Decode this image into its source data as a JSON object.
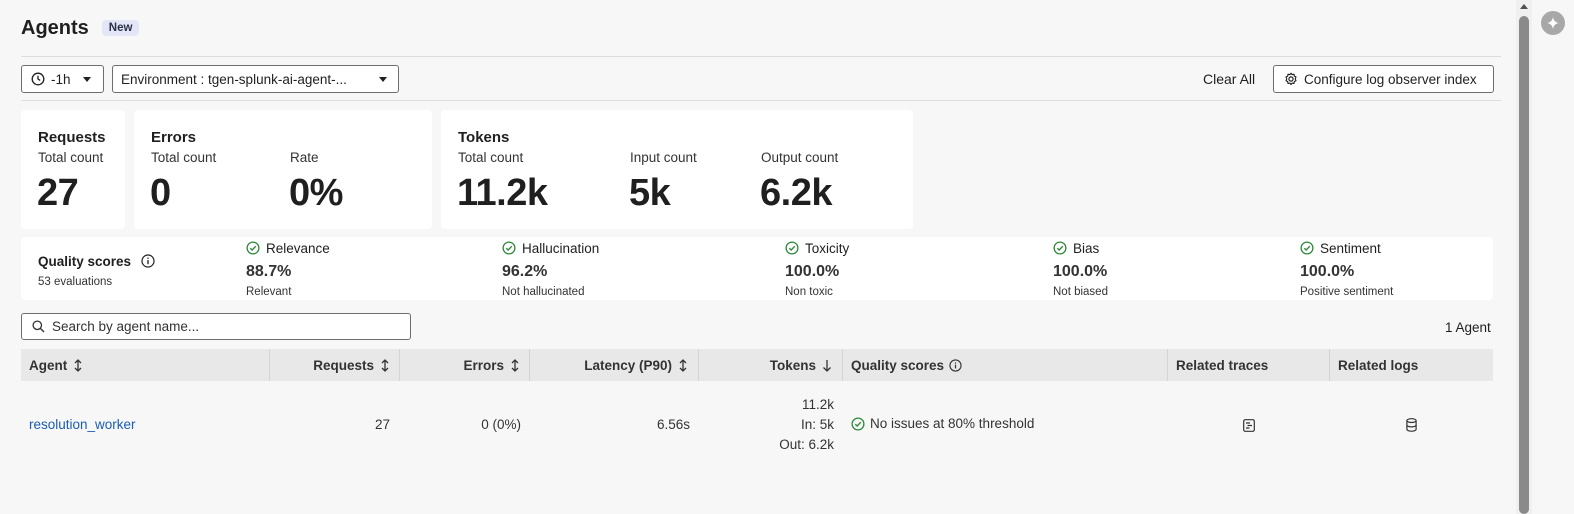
{
  "header": {
    "title": "Agents",
    "badge": "New"
  },
  "toolbar": {
    "time_label": "-1h",
    "environment_label": "Environment : tgen-splunk-ai-agent-...",
    "clear_all": "Clear All",
    "configure_label": "Configure log observer index"
  },
  "stats": {
    "requests": {
      "title": "Requests",
      "total_label": "Total count",
      "total_value": "27"
    },
    "errors": {
      "title": "Errors",
      "total_label": "Total count",
      "total_value": "0",
      "rate_label": "Rate",
      "rate_value": "0%"
    },
    "tokens": {
      "title": "Tokens",
      "total_label": "Total count",
      "total_value": "11.2k",
      "input_label": "Input count",
      "input_value": "5k",
      "output_label": "Output count",
      "output_value": "6.2k"
    }
  },
  "quality": {
    "title": "Quality scores",
    "subtitle": "53 evaluations",
    "items": [
      {
        "name": "Relevance",
        "value": "88.7%",
        "desc": "Relevant"
      },
      {
        "name": "Hallucination",
        "value": "96.2%",
        "desc": "Not hallucinated"
      },
      {
        "name": "Toxicity",
        "value": "100.0%",
        "desc": "Non toxic"
      },
      {
        "name": "Bias",
        "value": "100.0%",
        "desc": "Not biased"
      },
      {
        "name": "Sentiment",
        "value": "100.0%",
        "desc": "Positive sentiment"
      }
    ]
  },
  "search": {
    "placeholder": "Search by agent name..."
  },
  "agent_count": "1 Agent",
  "table": {
    "headers": {
      "agent": "Agent",
      "requests": "Requests",
      "errors": "Errors",
      "latency": "Latency (P90)",
      "tokens": "Tokens",
      "quality": "Quality scores",
      "traces": "Related traces",
      "logs": "Related logs"
    },
    "rows": [
      {
        "agent": "resolution_worker",
        "requests": "27",
        "errors": "0 (0%)",
        "latency": "6.56s",
        "tokens_total": "11.2k",
        "tokens_in": "In: 5k",
        "tokens_out": "Out: 6.2k",
        "quality": "No issues at 80% threshold"
      }
    ]
  },
  "colors": {
    "accent_green": "#2e8a3a",
    "link": "#1b5db5"
  }
}
